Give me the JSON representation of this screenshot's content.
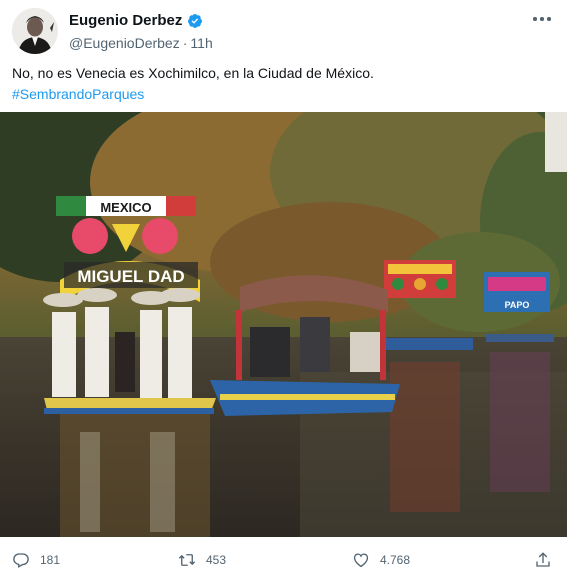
{
  "tweet": {
    "author_name": "Eugenio Derbez",
    "handle": "@EugenioDerbez",
    "separator": "·",
    "time": "11h",
    "text": "No, no es Venecia es Xochimilco, en la Ciudad de México.",
    "hashtag": "#SembrandoParques",
    "image_sign_main": "MEXICO",
    "image_sign_main_lower": "MIGUEL DAD",
    "image_sign_right": "PAPO"
  },
  "actions": {
    "replies": "181",
    "retweets": "453",
    "likes": "4.768"
  },
  "icons": {
    "verified": "verified-badge-icon",
    "more": "more-dots-icon",
    "reply": "reply-icon",
    "retweet": "retweet-icon",
    "like": "heart-icon",
    "share": "share-icon"
  },
  "colors": {
    "text": "#0f1419",
    "secondary": "#536471",
    "link": "#1d9bf0"
  }
}
